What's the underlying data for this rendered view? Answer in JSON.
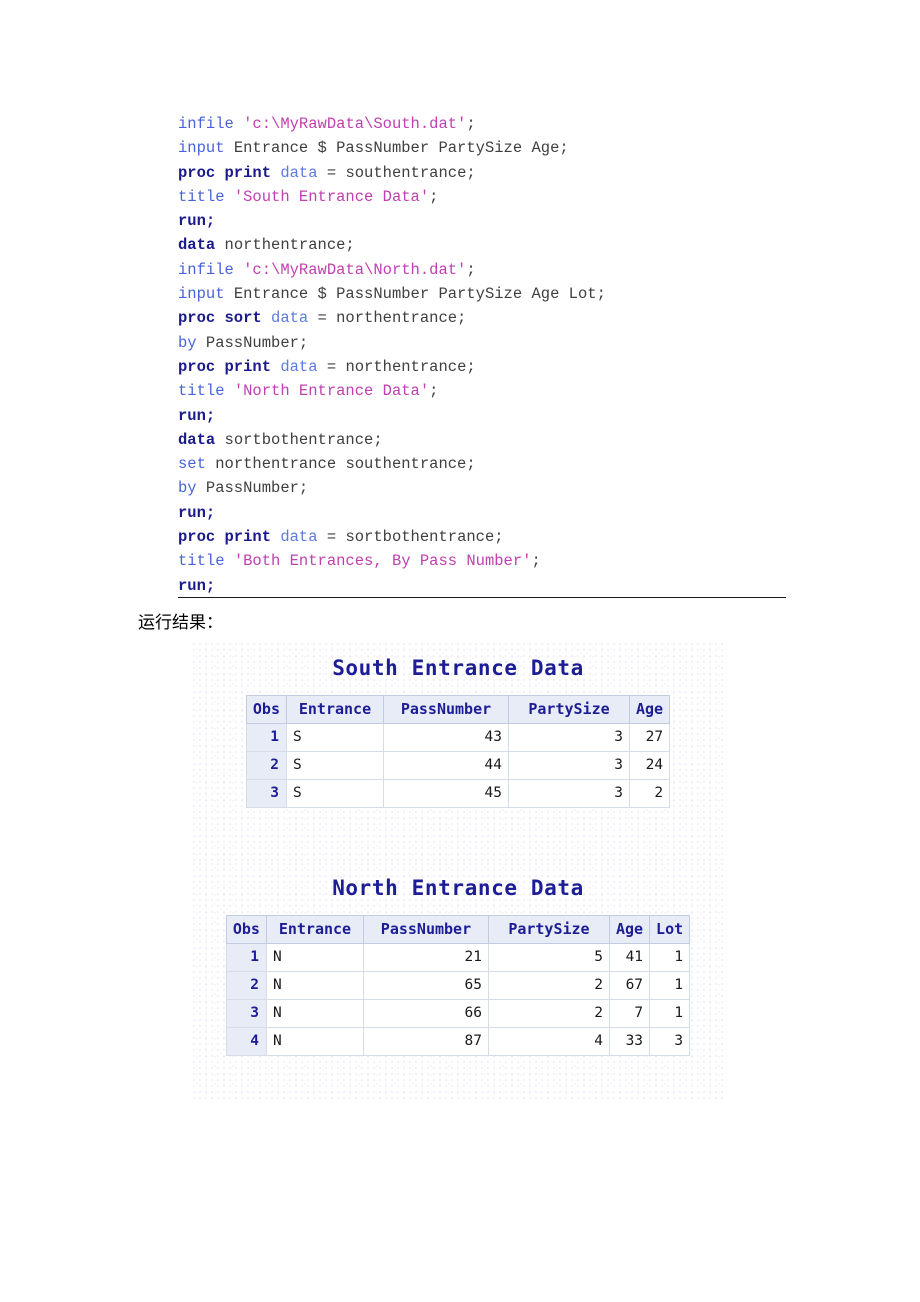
{
  "document": {
    "caption": "运行结果："
  },
  "code": {
    "language": "SAS",
    "lines": [
      [
        {
          "t": "infile ",
          "c": "kw-blue"
        },
        {
          "t": "'c:\\MyRawData\\South.dat'",
          "c": "str"
        },
        {
          "t": ";",
          "c": "plain"
        }
      ],
      [
        {
          "t": "input ",
          "c": "kw-blue"
        },
        {
          "t": "Entrance $ PassNumber PartySize Age;",
          "c": "plain"
        }
      ],
      [
        {
          "t": "proc print ",
          "c": "kw-bold"
        },
        {
          "t": "data ",
          "c": "kw-data"
        },
        {
          "t": "= southentrance;",
          "c": "plain"
        }
      ],
      [
        {
          "t": "title ",
          "c": "kw-blue"
        },
        {
          "t": "'South Entrance Data'",
          "c": "str"
        },
        {
          "t": ";",
          "c": "plain"
        }
      ],
      [
        {
          "t": "run;",
          "c": "kw-bold"
        }
      ],
      [
        {
          "t": "data ",
          "c": "kw-bold"
        },
        {
          "t": "northentrance;",
          "c": "plain"
        }
      ],
      [
        {
          "t": "infile ",
          "c": "kw-blue"
        },
        {
          "t": "'c:\\MyRawData\\North.dat'",
          "c": "str"
        },
        {
          "t": ";",
          "c": "plain"
        }
      ],
      [
        {
          "t": "input ",
          "c": "kw-blue"
        },
        {
          "t": "Entrance $ PassNumber PartySize Age Lot;",
          "c": "plain"
        }
      ],
      [
        {
          "t": "proc sort ",
          "c": "kw-bold"
        },
        {
          "t": "data ",
          "c": "kw-data"
        },
        {
          "t": "= northentrance;",
          "c": "plain"
        }
      ],
      [
        {
          "t": "by ",
          "c": "kw-blue"
        },
        {
          "t": "PassNumber;",
          "c": "plain"
        }
      ],
      [
        {
          "t": "proc print ",
          "c": "kw-bold"
        },
        {
          "t": "data ",
          "c": "kw-data"
        },
        {
          "t": "= northentrance;",
          "c": "plain"
        }
      ],
      [
        {
          "t": "title ",
          "c": "kw-blue"
        },
        {
          "t": "'North Entrance Data'",
          "c": "str"
        },
        {
          "t": ";",
          "c": "plain"
        }
      ],
      [
        {
          "t": "run;",
          "c": "kw-bold"
        }
      ],
      [
        {
          "t": "data ",
          "c": "kw-bold"
        },
        {
          "t": "sortbothentrance;",
          "c": "plain"
        }
      ],
      [
        {
          "t": "set ",
          "c": "kw-blue"
        },
        {
          "t": "northentrance southentrance;",
          "c": "plain"
        }
      ],
      [
        {
          "t": "by ",
          "c": "kw-blue"
        },
        {
          "t": "PassNumber;",
          "c": "plain"
        }
      ],
      [
        {
          "t": "run;",
          "c": "kw-bold"
        }
      ],
      [
        {
          "t": "proc print ",
          "c": "kw-bold"
        },
        {
          "t": "data ",
          "c": "kw-data"
        },
        {
          "t": "= sortbothentrance;",
          "c": "plain"
        }
      ],
      [
        {
          "t": "title ",
          "c": "kw-blue"
        },
        {
          "t": "'Both Entrances, By Pass Number'",
          "c": "str"
        },
        {
          "t": ";",
          "c": "plain"
        }
      ],
      [
        {
          "t": "run;",
          "c": "kw-bold"
        }
      ]
    ]
  },
  "output": {
    "south": {
      "title": "South Entrance Data",
      "columns": [
        "Obs",
        "Entrance",
        "PassNumber",
        "PartySize",
        "Age"
      ],
      "rows": [
        [
          "1",
          "S",
          "43",
          "3",
          "27"
        ],
        [
          "2",
          "S",
          "44",
          "3",
          "24"
        ],
        [
          "3",
          "S",
          "45",
          "3",
          "2"
        ]
      ]
    },
    "north": {
      "title": "North Entrance Data",
      "columns": [
        "Obs",
        "Entrance",
        "PassNumber",
        "PartySize",
        "Age",
        "Lot"
      ],
      "rows": [
        [
          "1",
          "N",
          "21",
          "5",
          "41",
          "1"
        ],
        [
          "2",
          "N",
          "65",
          "2",
          "67",
          "1"
        ],
        [
          "3",
          "N",
          "66",
          "2",
          "7",
          "1"
        ],
        [
          "4",
          "N",
          "87",
          "4",
          "33",
          "3"
        ]
      ]
    }
  },
  "colors": {
    "keyword_blue": "#4a63d8",
    "keyword_bold": "#1a1a8c",
    "data_keyword": "#5b7be0",
    "string_literal": "#c040b0",
    "plain_text": "#3f3f3f",
    "sas_title": "#1d1d96",
    "table_header_bg": "#e7ecf6",
    "table_border": "#c3ccdf"
  }
}
